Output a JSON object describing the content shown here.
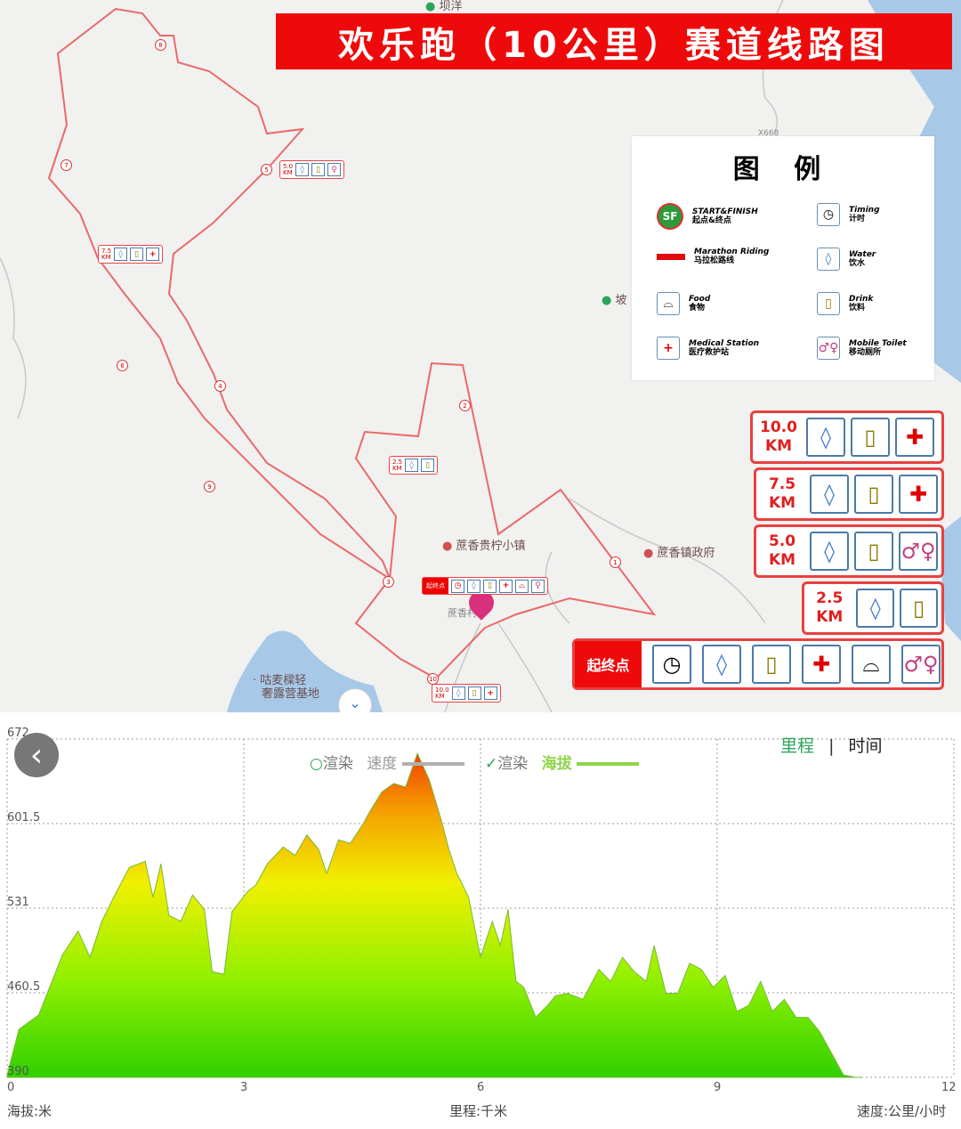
{
  "title": "欢乐跑（10公里）赛道线路图",
  "legend": {
    "heading": "图 例",
    "items": [
      {
        "en": "START&FINISH",
        "zh": "起点&终点",
        "icon": "start-finish-icon"
      },
      {
        "en": "Timing",
        "zh": "计时",
        "icon": "timing-icon"
      },
      {
        "en": "Marathon Riding",
        "zh": "马拉松路线",
        "icon": "route-line-icon"
      },
      {
        "en": "Water",
        "zh": "饮水",
        "icon": "water-icon"
      },
      {
        "en": "Food",
        "zh": "食物",
        "icon": "food-icon"
      },
      {
        "en": "Drink",
        "zh": "饮料",
        "icon": "drink-icon"
      },
      {
        "en": "Medical Station",
        "zh": "医疗救护站",
        "icon": "medical-icon"
      },
      {
        "en": "Mobile Toilet",
        "zh": "移动厕所",
        "icon": "toilet-icon"
      }
    ]
  },
  "stations": [
    {
      "km": "10.0\nKM",
      "services": [
        "water",
        "drink",
        "medical"
      ]
    },
    {
      "km": "7.5\nKM",
      "services": [
        "water",
        "drink",
        "medical"
      ]
    },
    {
      "km": "5.0\nKM",
      "services": [
        "water",
        "drink",
        "toilet"
      ]
    },
    {
      "km": "2.5\nKM",
      "services": [
        "water",
        "drink"
      ]
    }
  ],
  "start_finish": {
    "label": "起终点",
    "services": [
      "timing",
      "water",
      "drink",
      "medical",
      "food",
      "toilet"
    ]
  },
  "map_labels": {
    "village": "蔗香贵柠小镇",
    "gov": "蔗香镇政府",
    "town": "蔗香村",
    "camp_line1": "咕麦樑轻",
    "camp_line2": "奢露营基地",
    "place_top": "坝洋",
    "place_right": "坡",
    "road": "X668"
  },
  "mini_labels": {
    "km25": "2.5\nKM",
    "km50": "5.0\nKM",
    "km75": "7.5\nKM",
    "km100": "10.0\nKM",
    "start": "起终点"
  },
  "chart_data": {
    "type": "area",
    "x_unit_label": "里程:千米",
    "y_unit_label": "海拔:米",
    "speed_unit_label": "速度:公里/小时",
    "y_ticks": [
      "672",
      "601.5",
      "531",
      "460.5",
      "390"
    ],
    "x_ticks": [
      "0",
      "3",
      "6",
      "9",
      "12"
    ],
    "xlim": [
      0,
      12
    ],
    "ylim": [
      390,
      672
    ],
    "series_toggles": [
      {
        "check_label": "渲染",
        "name": "速度",
        "checked": false,
        "color": "#b0b0b0"
      },
      {
        "check_label": "渲染",
        "name": "海拔",
        "checked": true,
        "color": "#8fd44a"
      }
    ],
    "mode_tabs": {
      "active": "里程",
      "inactive": "时间"
    },
    "x": [
      0,
      0.15,
      0.4,
      0.7,
      0.9,
      1.05,
      1.2,
      1.35,
      1.55,
      1.75,
      1.85,
      1.95,
      2.05,
      2.2,
      2.35,
      2.5,
      2.6,
      2.75,
      2.85,
      3.05,
      3.15,
      3.3,
      3.5,
      3.65,
      3.8,
      3.95,
      4.05,
      4.2,
      4.35,
      4.5,
      4.6,
      4.75,
      4.9,
      5.05,
      5.2,
      5.35,
      5.5,
      5.6,
      5.7,
      5.85,
      6.0,
      6.15,
      6.25,
      6.35,
      6.45,
      6.55,
      6.7,
      6.85,
      6.95,
      7.1,
      7.3,
      7.5,
      7.65,
      7.8,
      7.95,
      8.1,
      8.2,
      8.35,
      8.5,
      8.65,
      8.8,
      8.95,
      9.1,
      9.25,
      9.4,
      9.55,
      9.7,
      9.85,
      10.0,
      10.15,
      10.3,
      10.45,
      10.6,
      10.75,
      10.85
    ],
    "y": [
      392,
      430,
      442,
      492,
      512,
      490,
      520,
      540,
      565,
      570,
      540,
      568,
      525,
      520,
      542,
      530,
      478,
      476,
      528,
      545,
      550,
      568,
      582,
      575,
      592,
      580,
      560,
      588,
      585,
      600,
      612,
      628,
      635,
      632,
      660,
      638,
      605,
      580,
      560,
      540,
      490,
      520,
      500,
      530,
      470,
      465,
      440,
      450,
      458,
      460,
      455,
      480,
      470,
      490,
      478,
      470,
      500,
      460,
      460,
      485,
      480,
      465,
      475,
      445,
      450,
      470,
      445,
      455,
      440,
      440,
      428,
      410,
      392,
      390,
      390
    ]
  }
}
